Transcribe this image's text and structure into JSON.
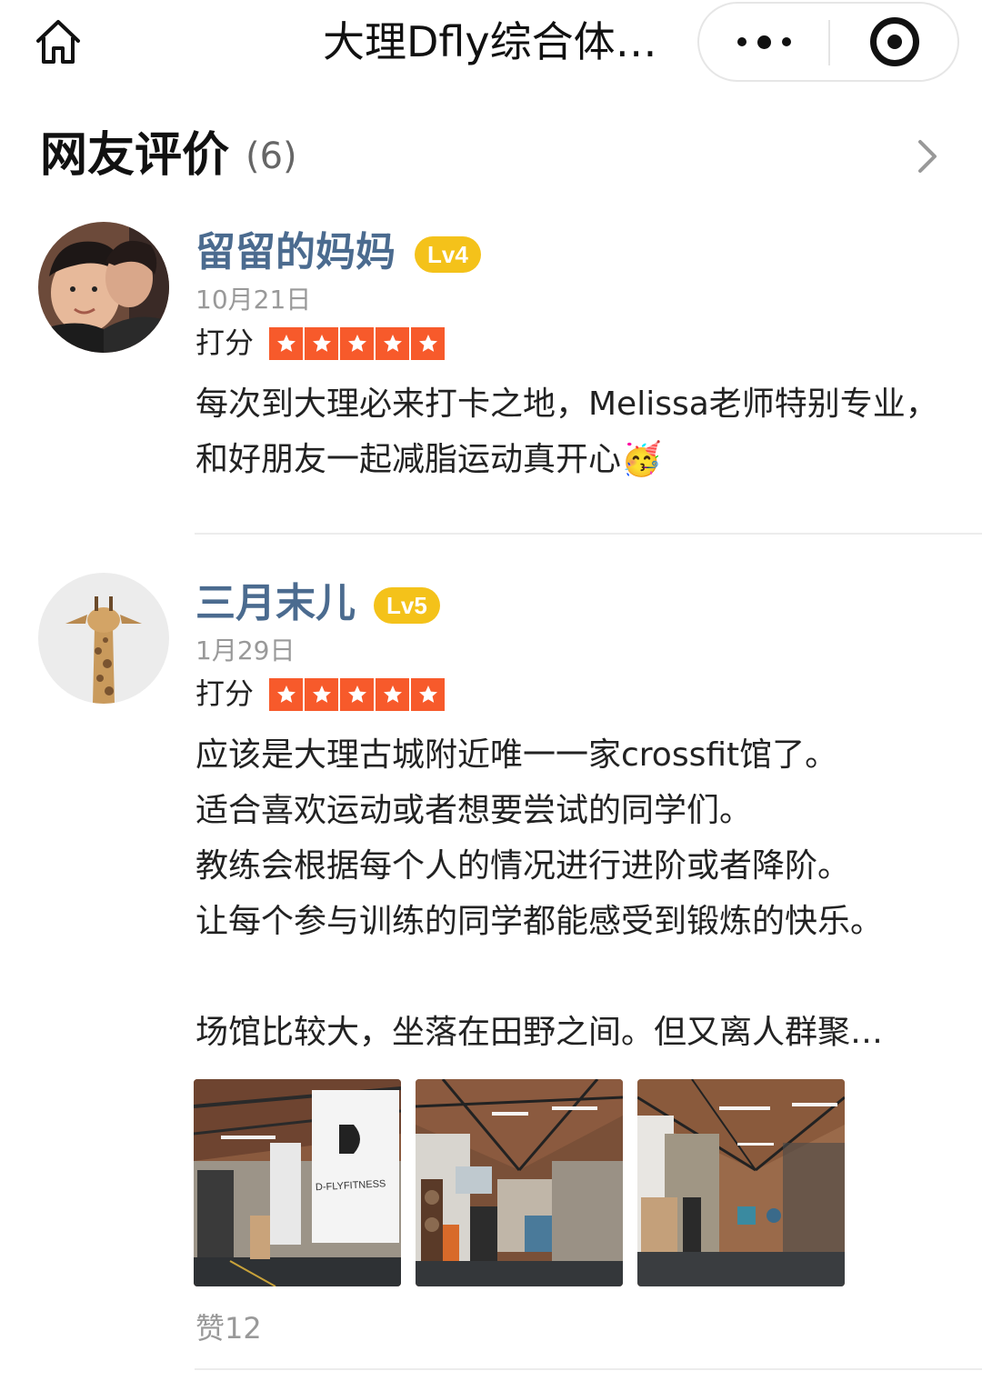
{
  "header": {
    "title": "大理Dfly综合体…",
    "home_icon": "home-icon",
    "more_icon": "more-dots-icon",
    "close_icon": "target-icon"
  },
  "section": {
    "title": "网友评价",
    "count": "(6)"
  },
  "reviews": [
    {
      "nickname": "留留的妈妈",
      "level": "Lv4",
      "date": "10月21日",
      "score_label": "打分",
      "stars": 5,
      "text": "每次到大理必来打卡之地，Melissa老师特别专业，和好朋友一起减脂运动真开心🥳"
    },
    {
      "nickname": "三月末儿",
      "level": "Lv5",
      "date": "1月29日",
      "score_label": "打分",
      "stars": 5,
      "text": "应该是大理古城附近唯一一家crossfit馆了。\n适合喜欢运动或者想要尝试的同学们。\n教练会根据每个人的情况进行进阶或者降阶。\n让每个参与训练的同学都能感受到锻炼的快乐。\n\n场馆比较大，坐落在田野之间。但又离人群聚…",
      "photo_sign_text": "D-FLYFITNESS",
      "likes": "赞12"
    }
  ],
  "colors": {
    "nickname": "#4b6b8f",
    "level_badge": "#f4c21a",
    "star_bg": "#f75a2b",
    "muted": "#999999"
  }
}
